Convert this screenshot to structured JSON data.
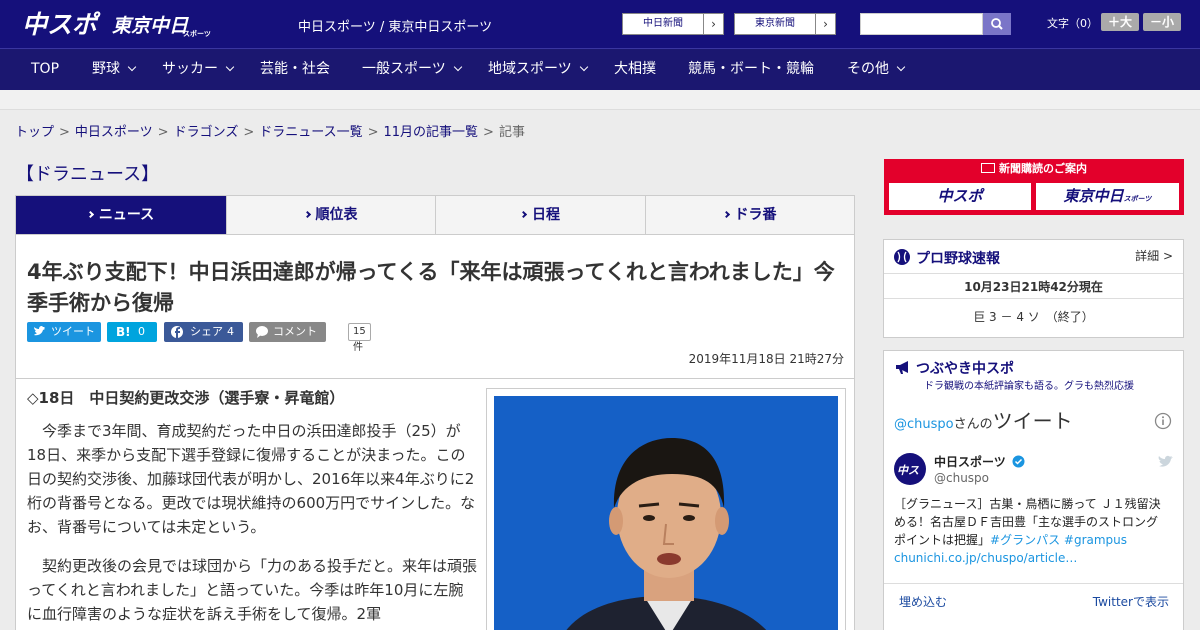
{
  "header": {
    "logo_main": "中スポ",
    "logo_sub": "東京中日",
    "logo_sub_small": "スポーツ",
    "site_links": "中日スポーツ / 東京中日スポーツ",
    "paper_chunichi": "中日新聞",
    "paper_tokyo": "東京新聞",
    "search_placeholder": "",
    "font_size_label": "文字（0）",
    "font_larger": "＋大",
    "font_smaller": "－小"
  },
  "nav": {
    "top": "TOP",
    "baseball": "野球",
    "soccer": "サッカー",
    "entertainment": "芸能・社会",
    "general_sports": "一般スポーツ",
    "regional_sports": "地域スポーツ",
    "sumo": "大相撲",
    "racing": "競馬・ボート・競輪",
    "other": "その他"
  },
  "breadcrumb": {
    "top": "トップ",
    "chunichi_sports": "中日スポーツ",
    "dragons": "ドラゴンズ",
    "dora_news_list": "ドラニュース一覧",
    "november_list": "11月の記事一覧",
    "current": "記事",
    "separator": ">"
  },
  "section_title": "【ドラニュース】",
  "tabs": {
    "news": "ニュース",
    "standings": "順位表",
    "schedule": "日程",
    "dora_ban": "ドラ番"
  },
  "article": {
    "headline": "4年ぶり支配下！中日浜田達郎が帰ってくる「来年は頑張ってくれと言われました」今季手術から復帰",
    "share_tweet": "ツイート",
    "share_hatena": "B!",
    "share_hatena_count": "0",
    "share_facebook": "シェア",
    "share_facebook_count": "4",
    "share_comment": "コメント",
    "comment_count": "15件",
    "published": "2019年11月18日 21時27分",
    "subhead": "◇18日　中日契約更改交渉（選手寮・昇竜館）",
    "paragraph1": "今季まで3年間、育成契約だった中日の浜田達郎投手（25）が18日、来季から支配下選手登録に復帰することが決まった。この日の契約交渉後、加藤球団代表が明かし、2016年以来4年ぶりに2桁の背番号となる。更改では現状維持の600万円でサインした。なお、背番号については未定という。",
    "paragraph2": "契約更改後の会見では球団から「力のある投手だと。来年は頑張ってくれと言われました」と語っていた。今季は昨年10月に左腕に血行障害のような症状を訴え手術をして復帰。2軍"
  },
  "sidebar": {
    "subscribe_title": "新聞購読のご案内",
    "subscribe_chuspo": "中スポ",
    "subscribe_tokyo": "東京中日",
    "subscribe_tokyo_small": "スポーツ",
    "baseball_title": "プロ野球速報",
    "baseball_detail": "詳細 >",
    "baseball_time": "10月23日21時42分現在",
    "baseball_score": "巨 3 － 4 ソ　（終了）",
    "tsubuyaki_title": "つぶやき中スポ",
    "tsubuyaki_sub": "ドラ観戦の本紙評論家も語る。グラも熱烈応援",
    "tweets_header_handle": "@chuspo",
    "tweets_header_san": "さんの",
    "tweets_header_big": "ツイート",
    "tweet_name": "中日スポーツ",
    "tweet_handle": "@chuspo",
    "tweet_text": "［グラニュース］古巣・鳥栖に勝って Ｊ１残留決める！名古屋ＤＦ吉田豊「主な選手のストロングポイントは把握」",
    "tweet_tag1": "#グランパス",
    "tweet_tag2": "#grampus",
    "tweet_link": "chunichi.co.jp/chuspo/article…",
    "tweet_embed": "埋め込む",
    "tweet_view": "Twitterで表示"
  },
  "colors": {
    "brand_navy": "#15107b",
    "subscribe_red": "#e3002b",
    "twitter_blue": "#1b95e0",
    "facebook_blue": "#3b5998",
    "hatena_blue": "#00a4de",
    "photo_bg": "#1560c6"
  }
}
